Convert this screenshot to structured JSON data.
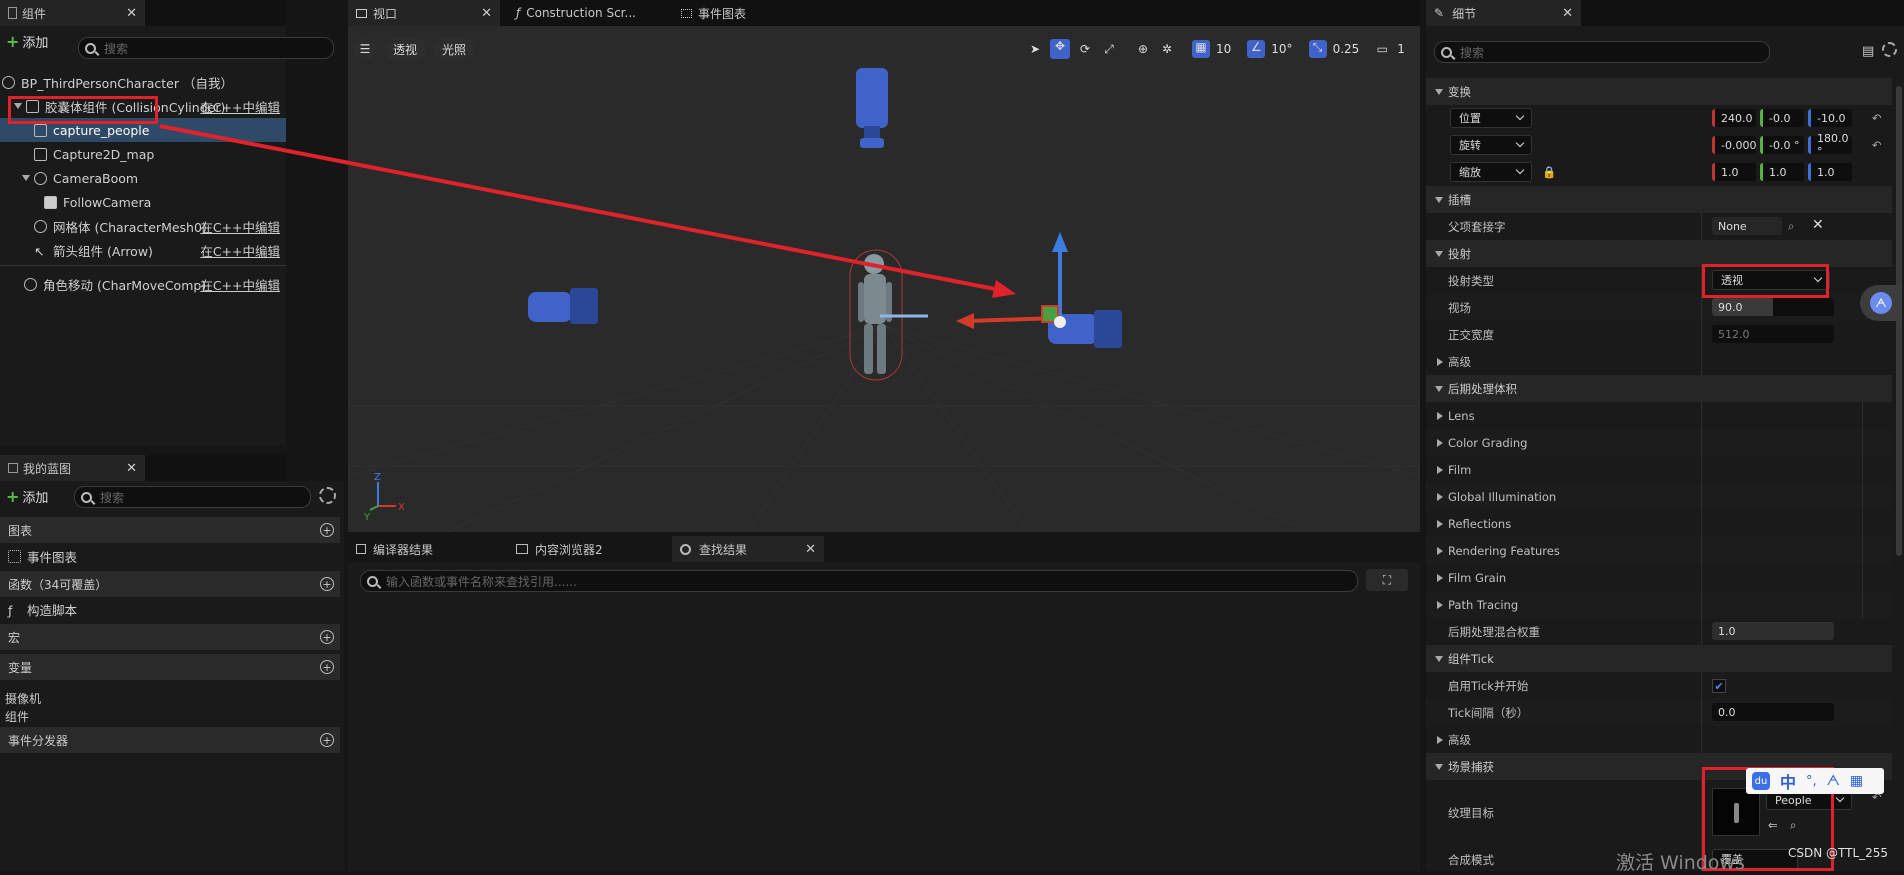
{
  "components_panel": {
    "tab_label": "组件",
    "add_label": "添加",
    "search_placeholder": "搜索",
    "items": [
      {
        "label": "BP_ThirdPersonCharacter （自我）",
        "link": ""
      },
      {
        "label": "胶囊体组件 (CollisionCylinder)",
        "link": "在C++中编辑"
      },
      {
        "label": "capture_people",
        "link": ""
      },
      {
        "label": "Capture2D_map",
        "link": ""
      },
      {
        "label": "CameraBoom",
        "link": ""
      },
      {
        "label": "FollowCamera",
        "link": ""
      },
      {
        "label": "网格体 (CharacterMesh0)",
        "link": "在C++中编辑"
      },
      {
        "label": "箭头组件 (Arrow)",
        "link": "在C++中编辑"
      },
      {
        "label": "角色移动 (CharMoveComp)",
        "link": "在C++中编辑"
      }
    ]
  },
  "blueprint_panel": {
    "tab_label": "我的蓝图",
    "add_label": "添加",
    "search_placeholder": "搜索",
    "sections": [
      {
        "label": "图表"
      },
      {
        "label": "事件图表"
      },
      {
        "label": "函数（34可覆盖）"
      },
      {
        "label": "构造脚本"
      },
      {
        "label": "宏"
      },
      {
        "label": "变量"
      },
      {
        "label": "摄像机"
      },
      {
        "label": "组件"
      },
      {
        "label": "事件分发器"
      }
    ]
  },
  "viewport": {
    "tabs": [
      {
        "label": "视口"
      },
      {
        "label": "Construction Scr..."
      },
      {
        "label": "事件图表"
      }
    ],
    "perspective_label": "透视",
    "lit_label": "光照",
    "grid_snap": "10",
    "rot_snap": "10°",
    "scale_snap": "0.25",
    "camera_speed": "1",
    "axis_x": "X",
    "axis_y": "Y",
    "axis_z": "Z"
  },
  "bottom_panel": {
    "tabs": [
      {
        "label": "编译器结果"
      },
      {
        "label": "内容浏览器2"
      },
      {
        "label": "查找结果"
      }
    ],
    "search_placeholder": "输入函数或事件名称来查找引用......"
  },
  "details_panel": {
    "tab_label": "细节",
    "search_placeholder": "搜索",
    "transform": {
      "header": "变换",
      "location_label": "位置",
      "location": [
        "240.0",
        "-0.0",
        "-10.0"
      ],
      "rotation_label": "旋转",
      "rotation": [
        "-0.000",
        "-0.0 °",
        "180.0 °"
      ],
      "scale_label": "缩放",
      "scale": [
        "1.0",
        "1.0",
        "1.0"
      ]
    },
    "sockets": {
      "header": "插槽",
      "parent_socket_label": "父项套接字",
      "parent_socket_value": "None"
    },
    "projection": {
      "header": "投射",
      "type_label": "投射类型",
      "type_value": "透视",
      "fov_label": "视场",
      "fov_value": "90.0",
      "fov_fraction": 0.5,
      "ortho_label": "正交宽度",
      "ortho_value": "512.0",
      "advanced_label": "高级"
    },
    "post_process": {
      "header": "后期处理体积",
      "items": [
        "Lens",
        "Color Grading",
        "Film",
        "Global Illumination",
        "Reflections",
        "Rendering Features",
        "Film Grain",
        "Path Tracing"
      ],
      "blend_label": "后期处理混合权重",
      "blend_value": "1.0"
    },
    "component_tick": {
      "header": "组件Tick",
      "start_label": "启用Tick并开始",
      "interval_label": "Tick间隔（秒）",
      "interval_value": "0.0",
      "advanced_label": "高级"
    },
    "scene_capture": {
      "header": "场景捕获",
      "texture_label": "纹理目标",
      "texture_value": "People",
      "composite_label": "合成模式",
      "composite_value": "覆盖"
    }
  },
  "overlay": {
    "ime_chinese": "中",
    "ime_punct": "°,",
    "watermark": "激活 Windows",
    "credit": "CSDN @TTL_255"
  },
  "colors": {
    "accent_red": "#e0222b",
    "selection": "#2f4a66",
    "camera_blue": "#3f63c8"
  }
}
